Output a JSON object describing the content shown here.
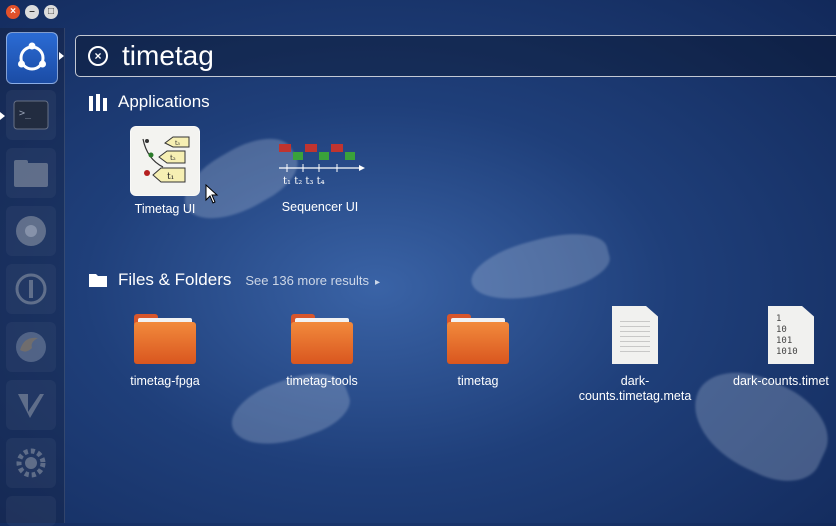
{
  "window_controls": {
    "close": "×",
    "minimize": "–",
    "maximize": "□"
  },
  "search": {
    "query": "timetag"
  },
  "sections": {
    "applications": {
      "title": "Applications"
    },
    "files": {
      "title": "Files & Folders",
      "see_more": "See 136 more results"
    }
  },
  "apps": [
    {
      "label": "Timetag UI",
      "icon": "timetag-ui-icon"
    },
    {
      "label": "Sequencer UI",
      "icon": "sequencer-ui-icon"
    }
  ],
  "files": [
    {
      "label": "timetag-fpga",
      "icon": "folder-icon"
    },
    {
      "label": "timetag-tools",
      "icon": "folder-icon"
    },
    {
      "label": "timetag",
      "icon": "folder-icon"
    },
    {
      "label": "dark-\ncounts.timetag.meta",
      "icon": "text-file-icon"
    },
    {
      "label": "dark-counts.timet",
      "icon": "binary-file-icon"
    }
  ],
  "binary_icon_text": "1\n10\n101\n1010",
  "colors": {
    "accent": "#2b6bd4",
    "folder": "#e96b2c",
    "close": "#e2512a"
  }
}
